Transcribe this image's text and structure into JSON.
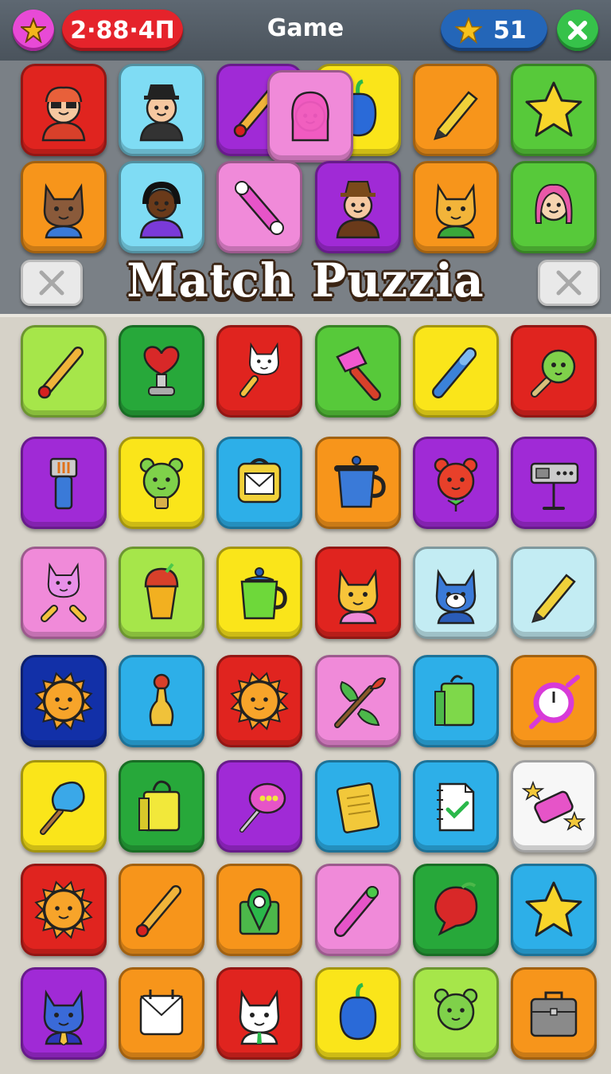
{
  "header": {
    "timer": "2·88·4Π",
    "title": "Game",
    "score": "51"
  },
  "banner": "Match Puzzia",
  "colors": {
    "red": "#e0241f",
    "cyan": "#7fdcf4",
    "purple": "#a02ad6",
    "yellow": "#fae51a",
    "orange": "#f7951b",
    "green": "#57c93a",
    "lime": "#a6e64a",
    "pink": "#f08ad9",
    "blue": "#2dafe8",
    "navy": "#1230a8",
    "darkgreen": "#27a83a",
    "lightcyan": "#c3ecf3",
    "white": "#f7f7f7"
  },
  "upper_tiles": [
    {
      "color": "red",
      "icon": "girl-sunglasses-icon"
    },
    {
      "color": "cyan",
      "icon": "man-bowler-hat-icon"
    },
    {
      "color": "purple",
      "icon": "paintbrush-icon"
    },
    {
      "color": "pink",
      "icon": "girl-pink-hood-icon"
    },
    {
      "color": "yellow",
      "icon": "pepper-icon"
    },
    {
      "color": "orange",
      "icon": "pencil-icon"
    },
    {
      "color": "green",
      "icon": "star-icon"
    },
    {
      "color": "orange",
      "icon": "cat-boy-icon"
    },
    {
      "color": "cyan",
      "icon": "girl-dark-hair-icon"
    },
    {
      "color": "pink",
      "icon": "bone-brush-icon"
    },
    {
      "color": "purple",
      "icon": "man-brown-hat-icon"
    },
    {
      "color": "orange",
      "icon": "fox-icon"
    },
    {
      "color": "green",
      "icon": "girl-pink-hair-icon"
    }
  ],
  "board": [
    [
      {
        "color": "lime",
        "icon": "paintbrush-icon"
      },
      {
        "color": "darkgreen",
        "icon": "heart-lamp-icon"
      },
      {
        "color": "red",
        "icon": "cat-rattle-icon"
      },
      {
        "color": "green",
        "icon": "hammer-icon"
      },
      {
        "color": "yellow",
        "icon": "pen-icon"
      },
      {
        "color": "red",
        "icon": "green-rattle-icon"
      }
    ],
    [
      {
        "color": "purple",
        "icon": "spray-bottle-icon"
      },
      {
        "color": "yellow",
        "icon": "bear-bulb-icon"
      },
      {
        "color": "blue",
        "icon": "mail-bag-icon"
      },
      {
        "color": "orange",
        "icon": "mug-icon"
      },
      {
        "color": "purple",
        "icon": "bear-balloon-icon"
      },
      {
        "color": "purple",
        "icon": "sign-post-icon"
      }
    ],
    [
      {
        "color": "pink",
        "icon": "cat-dumbbell-icon"
      },
      {
        "color": "lime",
        "icon": "cupcake-icon"
      },
      {
        "color": "yellow",
        "icon": "teapot-icon"
      },
      {
        "color": "red",
        "icon": "cat-girl-icon"
      },
      {
        "color": "lightcyan",
        "icon": "wolf-icon"
      },
      {
        "color": "lightcyan",
        "icon": "pencil-icon"
      }
    ],
    [
      {
        "color": "navy",
        "icon": "sun-icon"
      },
      {
        "color": "blue",
        "icon": "bowling-pin-icon"
      },
      {
        "color": "red",
        "icon": "sun-icon"
      },
      {
        "color": "pink",
        "icon": "leaf-brush-icon"
      },
      {
        "color": "blue",
        "icon": "shopping-bag-icon"
      },
      {
        "color": "orange",
        "icon": "stopwatch-icon"
      }
    ],
    [
      {
        "color": "yellow",
        "icon": "ice-cream-icon"
      },
      {
        "color": "darkgreen",
        "icon": "gift-bag-icon"
      },
      {
        "color": "purple",
        "icon": "lollipop-icon"
      },
      {
        "color": "blue",
        "icon": "notepad-icon"
      },
      {
        "color": "blue",
        "icon": "checklist-icon"
      },
      {
        "color": "white",
        "icon": "candy-stars-icon"
      }
    ],
    [
      {
        "color": "red",
        "icon": "sun-icon"
      },
      {
        "color": "orange",
        "icon": "paintbrush-icon"
      },
      {
        "color": "orange",
        "icon": "map-pin-box-icon"
      },
      {
        "color": "pink",
        "icon": "marker-icon"
      },
      {
        "color": "darkgreen",
        "icon": "speech-bubble-icon"
      },
      {
        "color": "blue",
        "icon": "star-icon"
      }
    ],
    [
      {
        "color": "purple",
        "icon": "cat-tie-icon"
      },
      {
        "color": "orange",
        "icon": "calendar-mail-icon"
      },
      {
        "color": "red",
        "icon": "cat-shirt-icon"
      },
      {
        "color": "yellow",
        "icon": "pepper-icon"
      },
      {
        "color": "lime",
        "icon": "bear-face-icon"
      },
      {
        "color": "orange",
        "icon": "briefcase-icon"
      }
    ]
  ]
}
